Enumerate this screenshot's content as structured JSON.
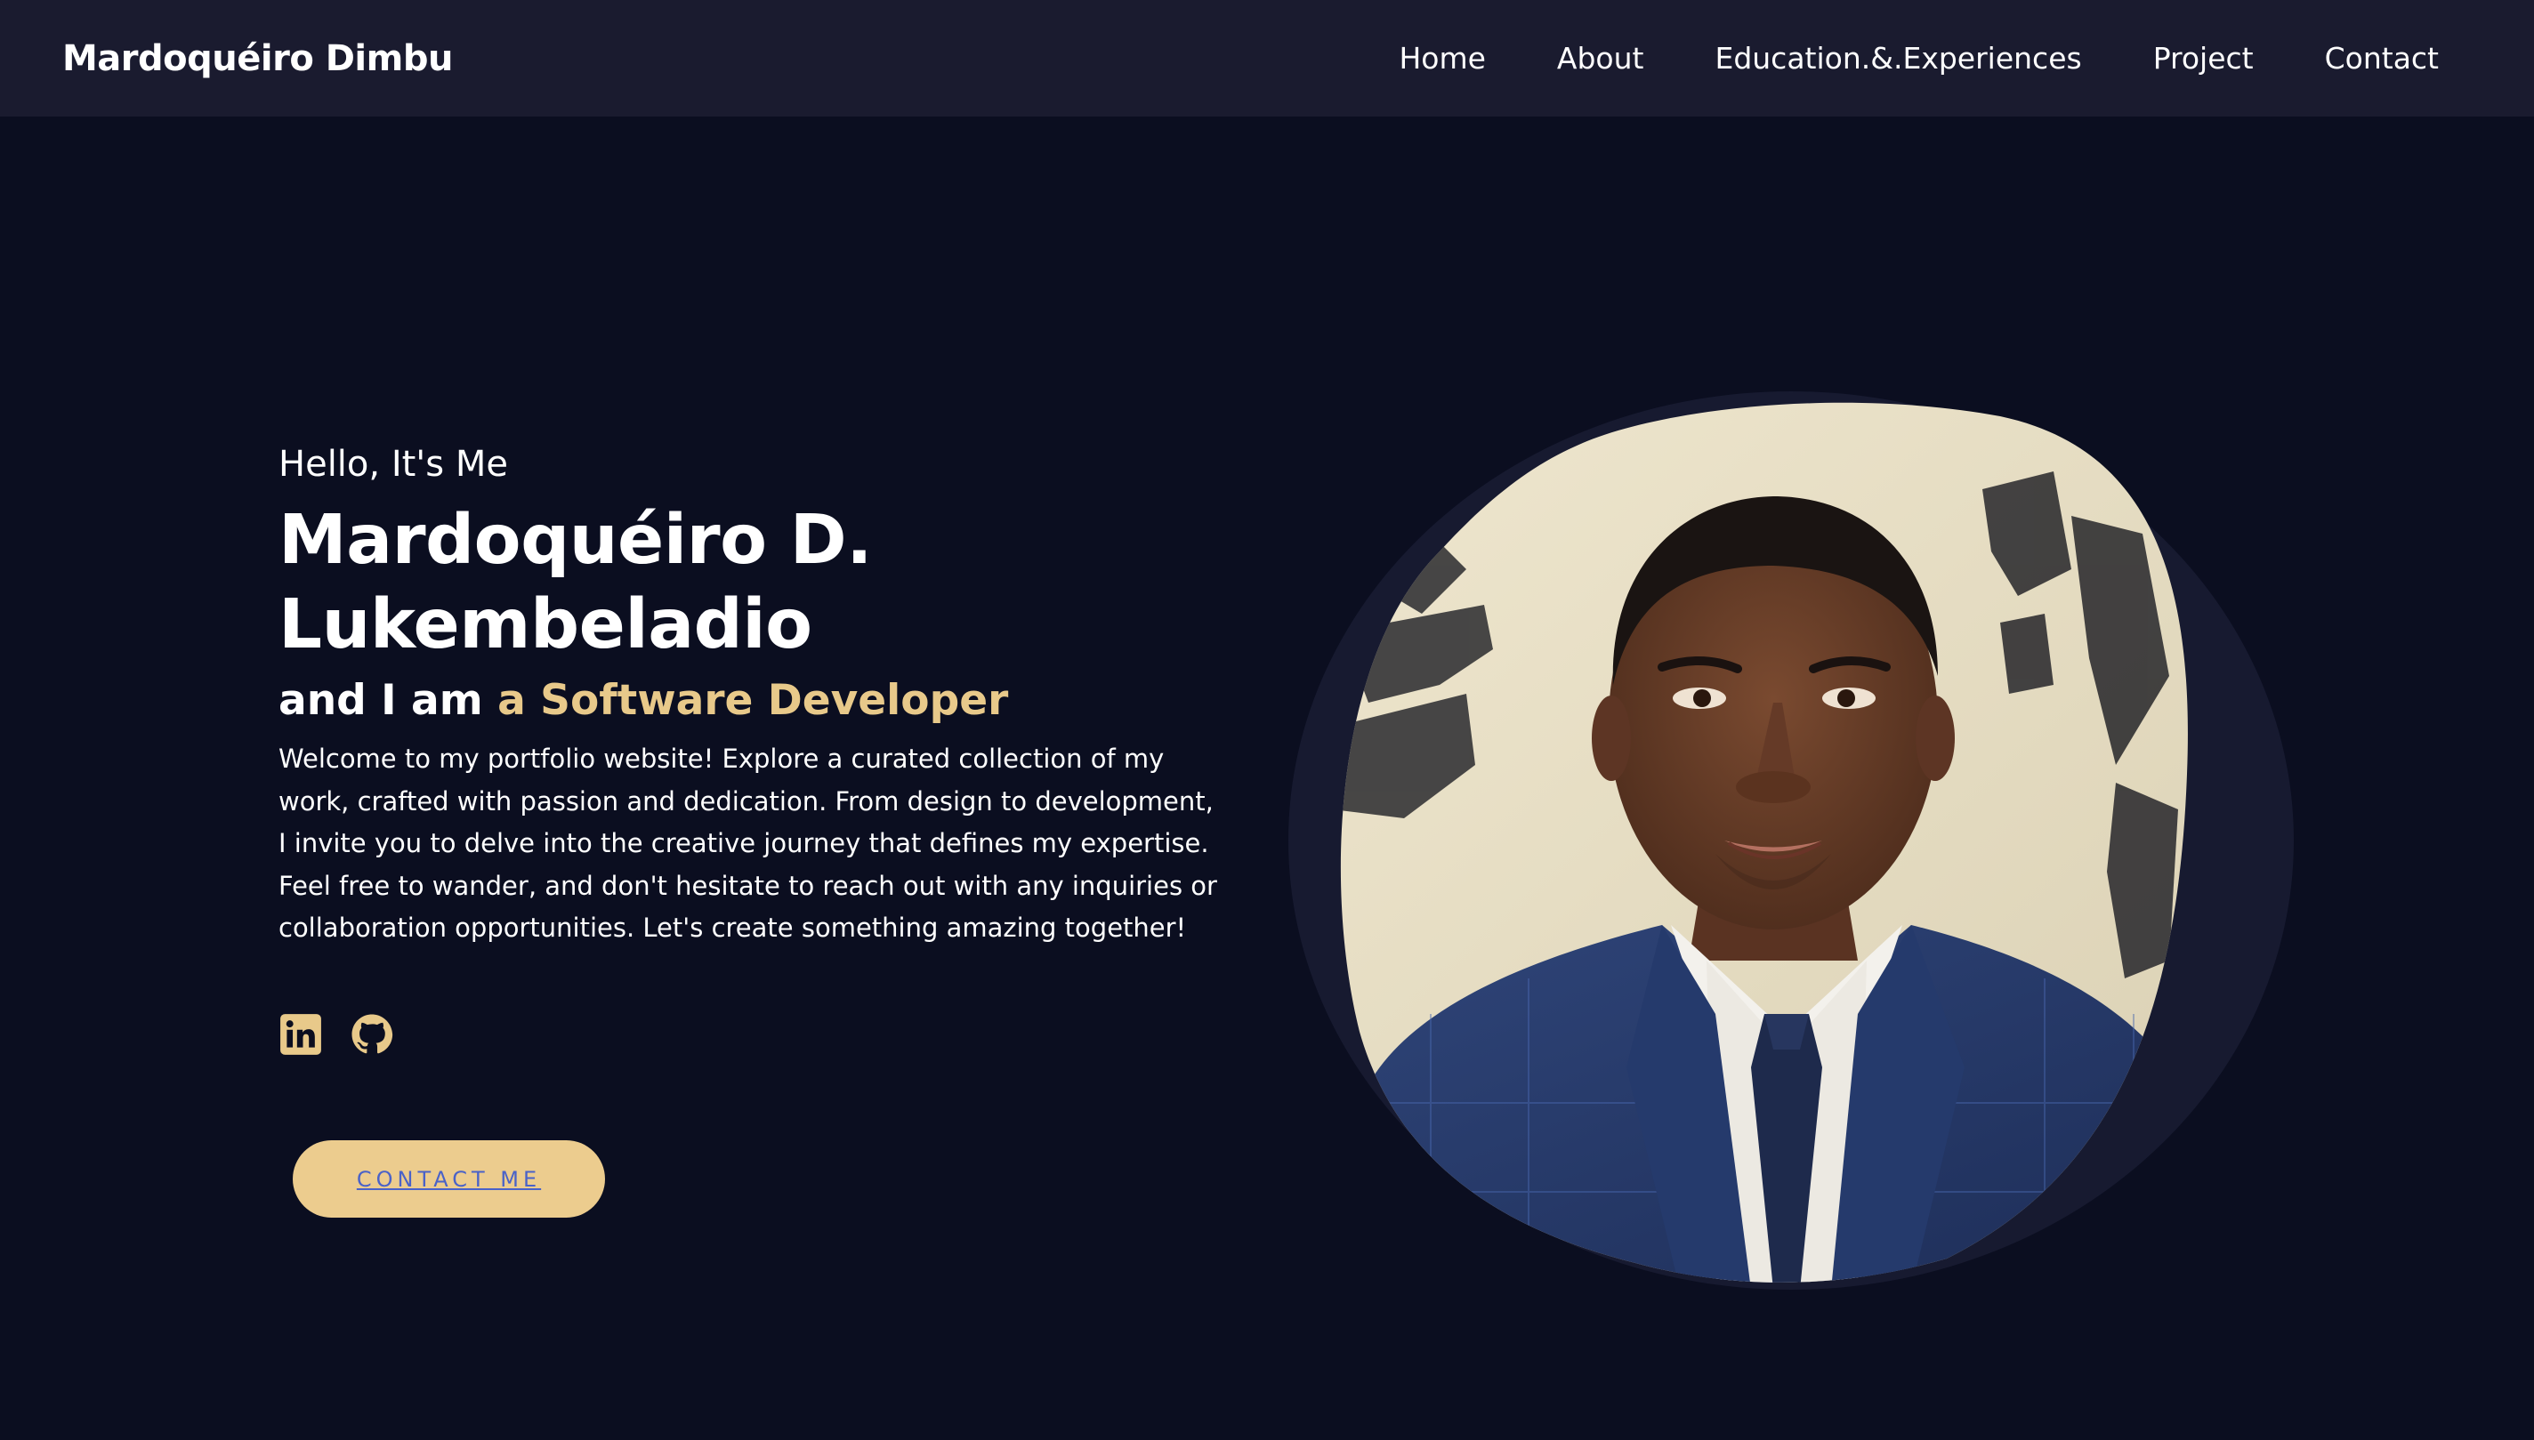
{
  "nav": {
    "brand": "Mardoquéiro Dimbu",
    "links": [
      "Home",
      "About",
      "Education.&.Experiences",
      "Project",
      "Contact"
    ]
  },
  "hero": {
    "greeting": "Hello, It's Me",
    "name_line1": "Mardoquéiro D.",
    "name_line2": "Lukembeladio",
    "role_prefix": "and I am ",
    "role_highlight": "a Software Developer",
    "intro": "Welcome to my portfolio website! Explore a curated collection of my work, crafted with passion and dedication. From design to development, I invite you to delve into the creative journey that defines my expertise. Feel free to wander, and don't hesitate to reach out with any inquiries or collaboration opportunities. Let's create something amazing together!",
    "contact_button": "Contact Me"
  },
  "socials": {
    "icons": [
      "linkedin-icon",
      "github-icon"
    ]
  },
  "colors": {
    "background": "#0b0e20",
    "navbar": "#1a1b2f",
    "accent": "#e8c98a",
    "button": "#eccc8e",
    "button_text": "#4a62c8"
  }
}
